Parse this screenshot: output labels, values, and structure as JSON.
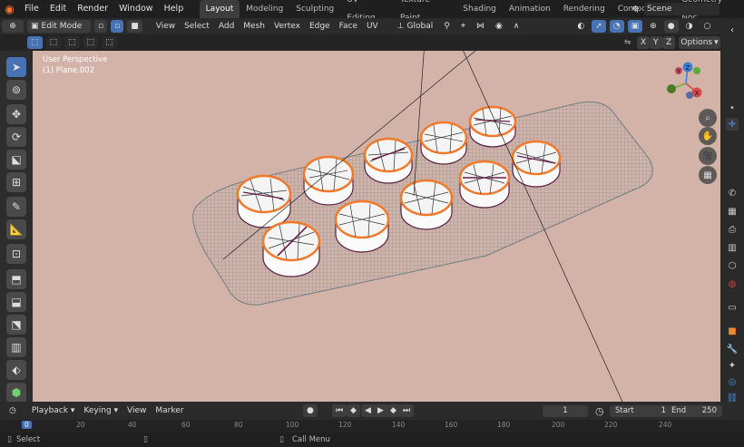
{
  "menu": {
    "logo": "blender-logo",
    "items": [
      "File",
      "Edit",
      "Render",
      "Window",
      "Help"
    ]
  },
  "workspaces": [
    "Layout",
    "Modeling",
    "Sculpting",
    "UV Editing",
    "Texture Paint",
    "Shading",
    "Animation",
    "Rendering",
    "Compositing",
    "Geometry Noc"
  ],
  "scene": {
    "label": "Scene"
  },
  "header": {
    "mode": "Edit Mode",
    "menus": [
      "View",
      "Select",
      "Add",
      "Mesh",
      "Vertex",
      "Edge",
      "Face",
      "UV"
    ],
    "orientation": "Global"
  },
  "header3": {
    "axes": [
      "X",
      "Y",
      "Z"
    ],
    "options": "Options"
  },
  "viewport": {
    "perspective": "User Perspective",
    "object": "(1) Plane.002",
    "background": "#d3b2a8",
    "mesh_color": "#7f8e90",
    "highlight": "#f07a2a"
  },
  "gizmo": {
    "x": "X",
    "y": "Y",
    "z": "Z"
  },
  "timeline": {
    "menus": [
      "Playback",
      "Keying",
      "View",
      "Marker"
    ],
    "current_frame": "1",
    "start_label": "Start",
    "start": "1",
    "end_label": "End",
    "end": "250"
  },
  "ruler": {
    "ticks": [
      "0",
      "20",
      "40",
      "60",
      "80",
      "100",
      "120",
      "140",
      "160",
      "180",
      "200",
      "220",
      "240"
    ]
  },
  "status": {
    "left": "Select",
    "middle": "Call Menu"
  },
  "colors": {
    "accent": "#4772b3",
    "orange": "#f07a2a"
  }
}
